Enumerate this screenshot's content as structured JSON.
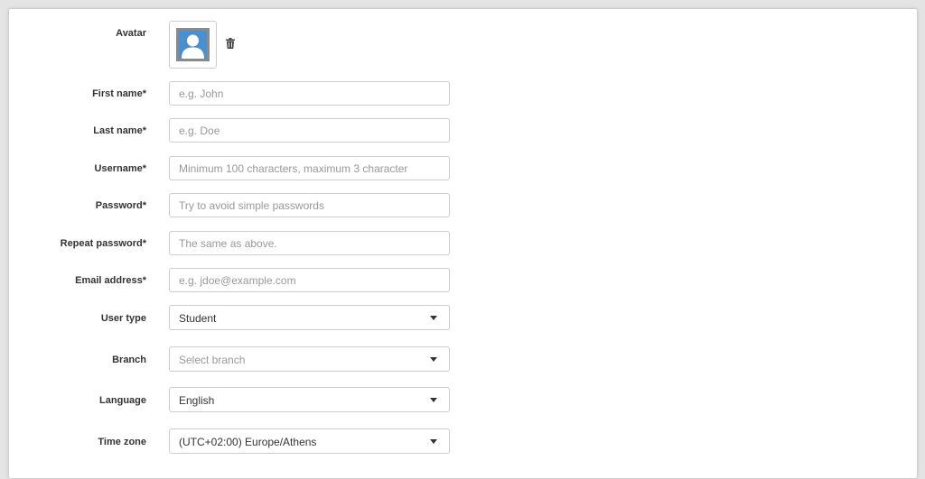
{
  "avatar": {
    "label": "Avatar",
    "icon": "user-silhouette-icon",
    "delete_icon": "trash-icon"
  },
  "fields": {
    "first_name": {
      "label": "First name*",
      "placeholder": "e.g. John",
      "value": ""
    },
    "last_name": {
      "label": "Last name*",
      "placeholder": "e.g. Doe",
      "value": ""
    },
    "username": {
      "label": "Username*",
      "placeholder": "Minimum 100 characters, maximum 3 character",
      "value": ""
    },
    "password": {
      "label": "Password*",
      "placeholder": "Try to avoid simple passwords",
      "value": ""
    },
    "repeat_password": {
      "label": "Repeat password*",
      "placeholder": "The same as above.",
      "value": ""
    },
    "email": {
      "label": "Email address*",
      "placeholder": "e.g. jdoe@example.com",
      "value": ""
    }
  },
  "selects": {
    "user_type": {
      "label": "User type",
      "value": "Student"
    },
    "branch": {
      "label": "Branch",
      "placeholder": "Select branch",
      "value": ""
    },
    "language": {
      "label": "Language",
      "value": "English"
    },
    "time_zone": {
      "label": "Time zone",
      "value": "(UTC+02:00) Europe/Athens"
    }
  },
  "colors": {
    "avatar_bg": "#4a8fd0",
    "avatar_frame": "#8a8a8a",
    "border": "#cccccc"
  }
}
